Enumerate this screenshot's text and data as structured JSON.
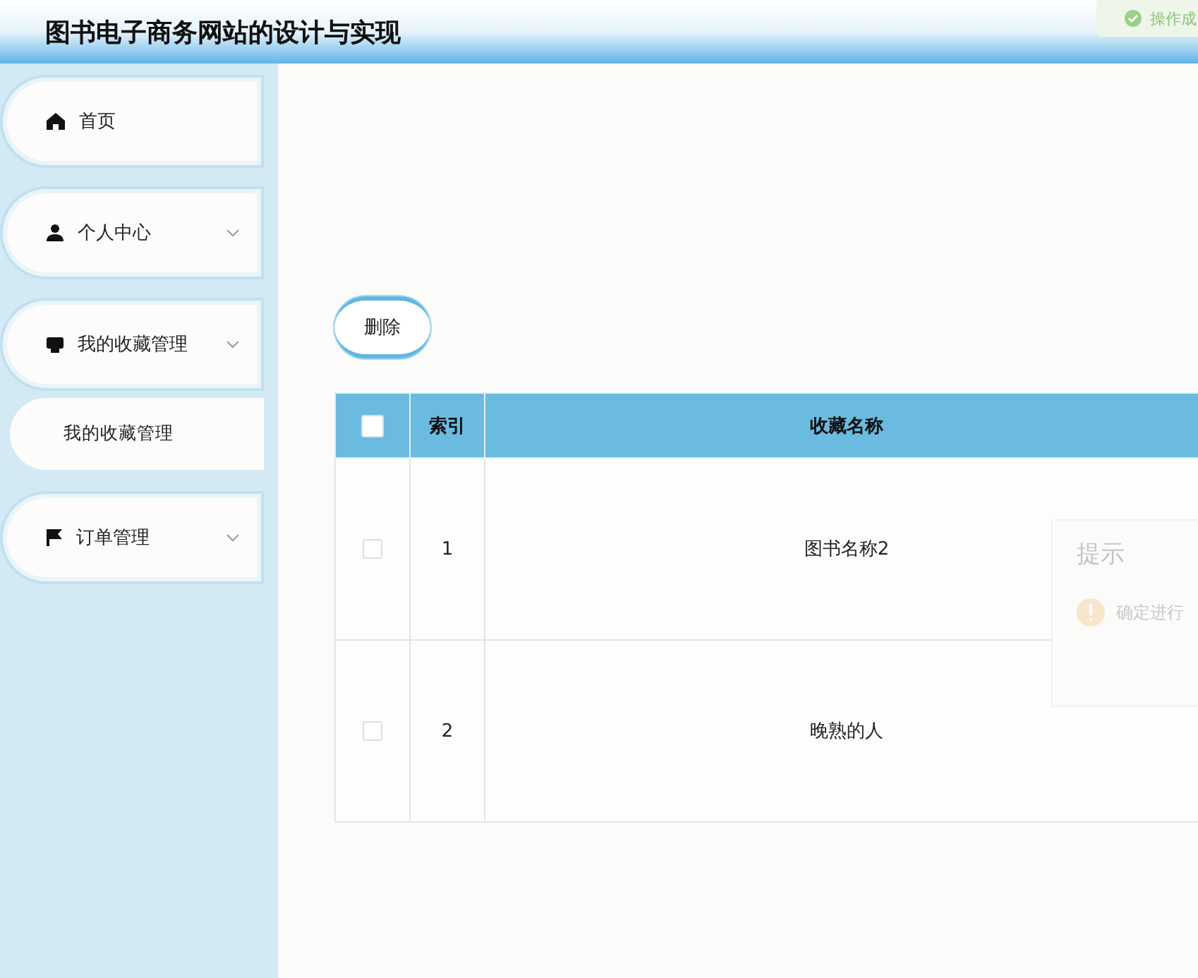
{
  "header": {
    "title": "图书电子商务网站的设计与实现"
  },
  "toast": {
    "text": "操作成"
  },
  "sidebar": {
    "items": [
      {
        "label": "首页",
        "kind": "link"
      },
      {
        "label": "个人中心",
        "kind": "group"
      },
      {
        "label": "我的收藏管理",
        "kind": "group",
        "children": [
          {
            "label": "我的收藏管理"
          }
        ]
      },
      {
        "label": "订单管理",
        "kind": "group"
      }
    ]
  },
  "toolbar": {
    "delete_button": "删除"
  },
  "table": {
    "all_checked": false,
    "columns": [
      "索引",
      "收藏名称"
    ],
    "rows": [
      {
        "checked": false,
        "index": "1",
        "name": "图书名称2"
      },
      {
        "checked": false,
        "index": "2",
        "name": "晚熟的人"
      }
    ]
  },
  "dialog": {
    "title": "提示",
    "message": "确定进行"
  }
}
